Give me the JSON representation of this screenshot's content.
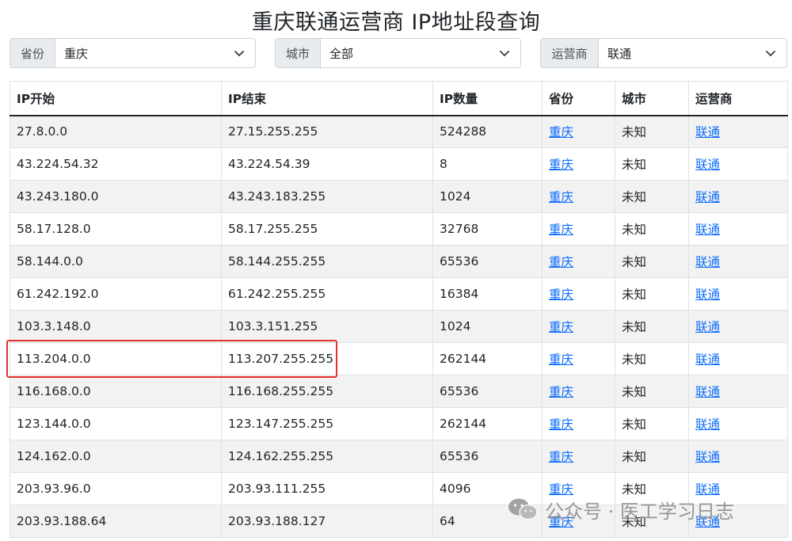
{
  "page": {
    "title": "重庆联通运营商 IP地址段查询"
  },
  "filters": {
    "province": {
      "label": "省份",
      "value": "重庆"
    },
    "city": {
      "label": "城市",
      "value": "全部"
    },
    "isp": {
      "label": "运营商",
      "value": "联通"
    }
  },
  "table": {
    "headers": [
      "IP开始",
      "IP结束",
      "IP数量",
      "省份",
      "城市",
      "运营商"
    ],
    "rows": [
      [
        "27.8.0.0",
        "27.15.255.255",
        "524288",
        "重庆",
        "未知",
        "联通"
      ],
      [
        "43.224.54.32",
        "43.224.54.39",
        "8",
        "重庆",
        "未知",
        "联通"
      ],
      [
        "43.243.180.0",
        "43.243.183.255",
        "1024",
        "重庆",
        "未知",
        "联通"
      ],
      [
        "58.17.128.0",
        "58.17.255.255",
        "32768",
        "重庆",
        "未知",
        "联通"
      ],
      [
        "58.144.0.0",
        "58.144.255.255",
        "65536",
        "重庆",
        "未知",
        "联通"
      ],
      [
        "61.242.192.0",
        "61.242.255.255",
        "16384",
        "重庆",
        "未知",
        "联通"
      ],
      [
        "103.3.148.0",
        "103.3.151.255",
        "1024",
        "重庆",
        "未知",
        "联通"
      ],
      [
        "113.204.0.0",
        "113.207.255.255",
        "262144",
        "重庆",
        "未知",
        "联通"
      ],
      [
        "116.168.0.0",
        "116.168.255.255",
        "65536",
        "重庆",
        "未知",
        "联通"
      ],
      [
        "123.144.0.0",
        "123.147.255.255",
        "262144",
        "重庆",
        "未知",
        "联通"
      ],
      [
        "124.162.0.0",
        "124.162.255.255",
        "65536",
        "重庆",
        "未知",
        "联通"
      ],
      [
        "203.93.96.0",
        "203.93.111.255",
        "4096",
        "重庆",
        "未知",
        "联通"
      ],
      [
        "203.93.188.64",
        "203.93.188.127",
        "64",
        "重庆",
        "未知",
        "联通"
      ]
    ]
  },
  "watermark": {
    "text": "公众号 · 医工学习日志"
  },
  "icons": {
    "dropdown": "chevron-down-icon",
    "watermark": "wechat-icon"
  },
  "colors": {
    "link": "#0d6efd",
    "highlight": "#e5322d",
    "stripe": "#f2f2f2"
  }
}
